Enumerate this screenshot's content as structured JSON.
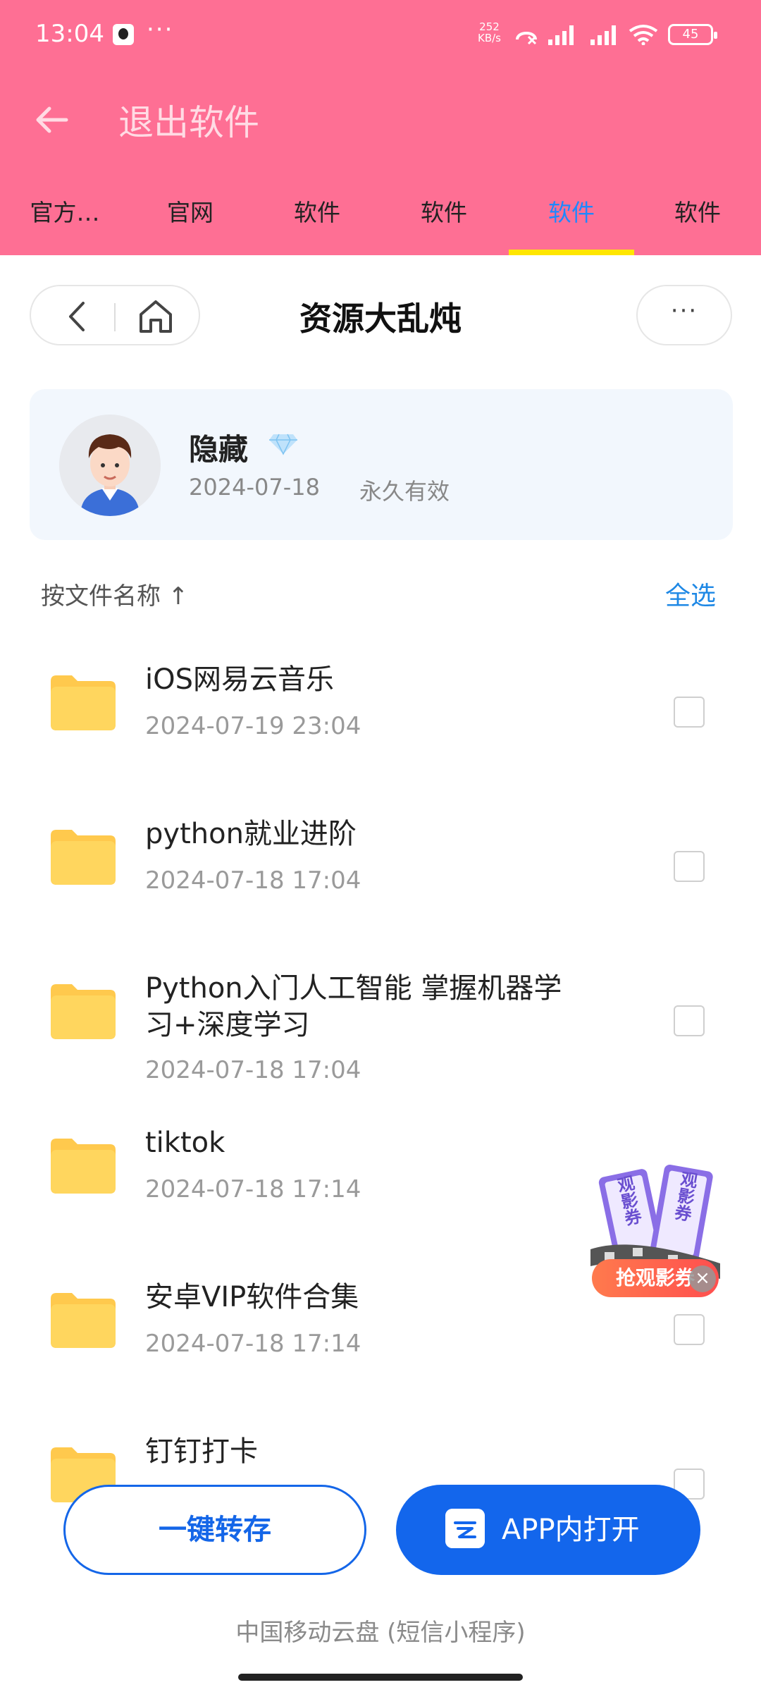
{
  "status_bar": {
    "time": "13:04",
    "more": "···",
    "speed_value": "252",
    "speed_unit": "KB/s",
    "battery": "45"
  },
  "header": {
    "title": "退出软件"
  },
  "tabs": [
    {
      "label": "官方…"
    },
    {
      "label": "官网"
    },
    {
      "label": "软件"
    },
    {
      "label": "软件"
    },
    {
      "label": "软件",
      "active": true
    },
    {
      "label": "软件"
    }
  ],
  "page": {
    "title": "资源大乱炖",
    "more": "···"
  },
  "owner": {
    "name": "隐藏",
    "date": "2024-07-18",
    "validity": "永久有效"
  },
  "list_controls": {
    "sort_label": "按文件名称 ↑",
    "select_all": "全选"
  },
  "files": [
    {
      "name": "iOS网易云音乐",
      "date": "2024-07-19 23:04"
    },
    {
      "name": "python就业进阶",
      "date": "2024-07-18 17:04"
    },
    {
      "name": "Python入门人工智能 掌握机器学习+深度学习",
      "date": "2024-07-18 17:04"
    },
    {
      "name": "tiktok",
      "date": "2024-07-18 17:14"
    },
    {
      "name": "安卓VIP软件合集",
      "date": "2024-07-18 17:14"
    },
    {
      "name": "钉钉打卡",
      "date": ""
    }
  ],
  "promo": {
    "label": "抢观影券",
    "close": "×",
    "ticket_text": "观影券"
  },
  "actions": {
    "save": "一键转存",
    "open_in_app": "APP内打开"
  },
  "footer": "中国移动云盘 (短信小程序)",
  "colors": {
    "header_bg": "#fe6f94",
    "accent": "#1466e8",
    "tab_indicator": "#ffe600"
  }
}
